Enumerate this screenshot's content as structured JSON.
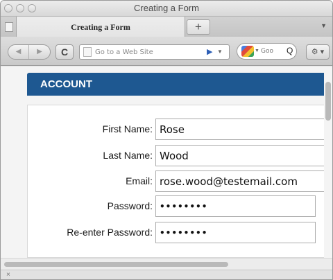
{
  "window": {
    "title": "Creating a Form"
  },
  "tabs": [
    {
      "label": "Creating a Form"
    }
  ],
  "toolbar": {
    "new_tab_label": "+",
    "back_glyph": "◀",
    "forward_glyph": "▶",
    "reload_glyph": "C",
    "address_placeholder": "Go to a Web Site",
    "go_glyph": "▶",
    "dropdown_glyph": "▼",
    "search_placeholder": "Goo",
    "search_glyph": "Q",
    "settings_glyph": "⚙ ▾"
  },
  "form": {
    "section_title": "ACCOUNT",
    "fields": [
      {
        "label": "First Name:",
        "value": "Rose"
      },
      {
        "label": "Last Name:",
        "value": "Wood"
      },
      {
        "label": "Email:",
        "value": "rose.wood@testemail.com"
      },
      {
        "label": "Password:",
        "value": "••••••••"
      },
      {
        "label": "Re-enter Password:",
        "value": "••••••••"
      }
    ]
  },
  "statusbar": {
    "close_glyph": "×"
  },
  "colors": {
    "header": "#1e5891"
  }
}
